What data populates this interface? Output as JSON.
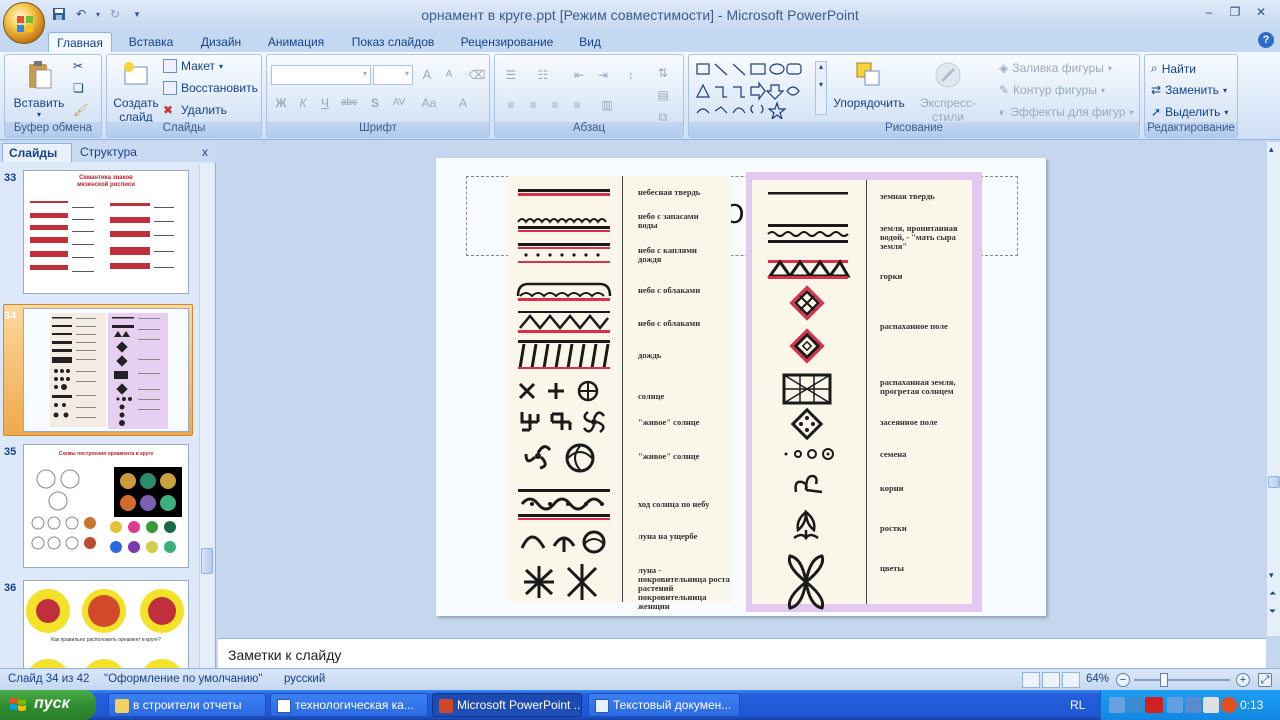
{
  "window": {
    "title": "орнамент в круге.ppt [Режим совместимости] - Microsoft PowerPoint"
  },
  "ribbon_tabs": [
    "Главная",
    "Вставка",
    "Дизайн",
    "Анимация",
    "Показ слайдов",
    "Рецензирование",
    "Вид"
  ],
  "ribbon": {
    "clipboard": {
      "label": "Буфер обмена",
      "paste": "Вставить"
    },
    "slides": {
      "label": "Слайды",
      "new_slide_l1": "Создать",
      "new_slide_l2": "слайд",
      "layout": "Макет",
      "reset": "Восстановить",
      "delete": "Удалить"
    },
    "font": {
      "label": "Шрифт",
      "bold": "Ж",
      "italic": "К",
      "underline": "Ч",
      "strike": "abc",
      "shadow": "S",
      "spacing": "AV",
      "case": "Aa",
      "color": "A",
      "grow": "A",
      "shrink": "A"
    },
    "paragraph": {
      "label": "Абзац"
    },
    "drawing": {
      "label": "Рисование",
      "arrange": "Упорядочить",
      "quick_styles": "Экспресс-стили",
      "fill": "Заливка фигуры",
      "outline": "Контур фигуры",
      "effects": "Эффекты для фигур"
    },
    "editing": {
      "label": "Редактирование",
      "find": "Найти",
      "replace": "Заменить",
      "select": "Выделить"
    }
  },
  "left_pane": {
    "tab_slides": "Слайды",
    "tab_outline": "Структура",
    "close": "x",
    "thumbnails": [
      {
        "number": "33",
        "title_l1": "Семантика знаков",
        "title_l2": "мезенской росписи"
      },
      {
        "number": "34"
      },
      {
        "number": "35",
        "title": "Схемы построения орнамента в круге"
      },
      {
        "number": "36",
        "caption": "Как правильно расположить орнамент в круге?"
      }
    ]
  },
  "slide": {
    "title_fragment": "О",
    "left_labels": [
      "небесная твердь",
      "небо с запасами воды",
      "небо с каплями дождя",
      "небо с облаками",
      "небо с облаками",
      "дождь",
      "солнце",
      "\"живое\" солнце",
      "\"живое\" солнце",
      "ход солнца по небу",
      "луна на ущербе",
      "луна - покровительница роста растений покровительница женщин"
    ],
    "right_labels": [
      "земная твердь",
      "земля, пропитанная водой, - \"мать сыра земля\"",
      "горки",
      "распаханное поле",
      "распаханная земля, прогретая солнцем",
      "засеянное поле",
      "семена",
      "корни",
      "ростки",
      "цветы"
    ]
  },
  "notes": {
    "placeholder": "Заметки к слайду"
  },
  "status": {
    "slide_info": "Слайд 34 из 42",
    "theme": "\"Оформление по умолчанию\"",
    "language": "русский",
    "zoom": "64%"
  },
  "taskbar": {
    "start": "пуск",
    "tasks": [
      "в строители отчеты",
      "технологическая ка...",
      "Microsoft PowerPoint ...",
      "Текстовый докумен..."
    ],
    "lang": "RL",
    "clock": "0:13"
  },
  "colors": {
    "accent_red": "#d9304a",
    "ornament": "#1a1a1a"
  }
}
